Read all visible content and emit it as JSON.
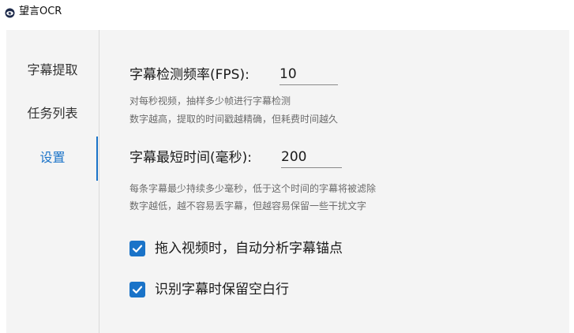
{
  "app": {
    "title": "望言OCR"
  },
  "sidebar": {
    "items": [
      {
        "label": "字幕提取",
        "active": false
      },
      {
        "label": "任务列表",
        "active": false
      },
      {
        "label": "设置",
        "active": true
      }
    ]
  },
  "settings": {
    "fps": {
      "label": "字幕检测频率(FPS):",
      "value": "10",
      "help": [
        "对每秒视频，抽样多少帧进行字幕检测",
        "数字越高，提取的时间戳越精确，但耗费时间越久"
      ]
    },
    "min_duration": {
      "label": "字幕最短时间(毫秒):",
      "value": "200",
      "help": [
        "每条字幕最少持续多少毫秒，低于这个时间的字幕将被滤除",
        "数字越低，越不容易丢字幕，但越容易保留一些干扰文字"
      ]
    },
    "auto_anchor": {
      "label": "拖入视频时，自动分析字幕锚点",
      "checked": true
    },
    "keep_blank": {
      "label": "识别字幕时保留空白行",
      "checked": true
    }
  },
  "colors": {
    "accent": "#1a73c8",
    "panel_bg": "#f4f4f4"
  },
  "icons": {
    "app": "eye-logo-icon",
    "check": "checkmark-icon"
  }
}
